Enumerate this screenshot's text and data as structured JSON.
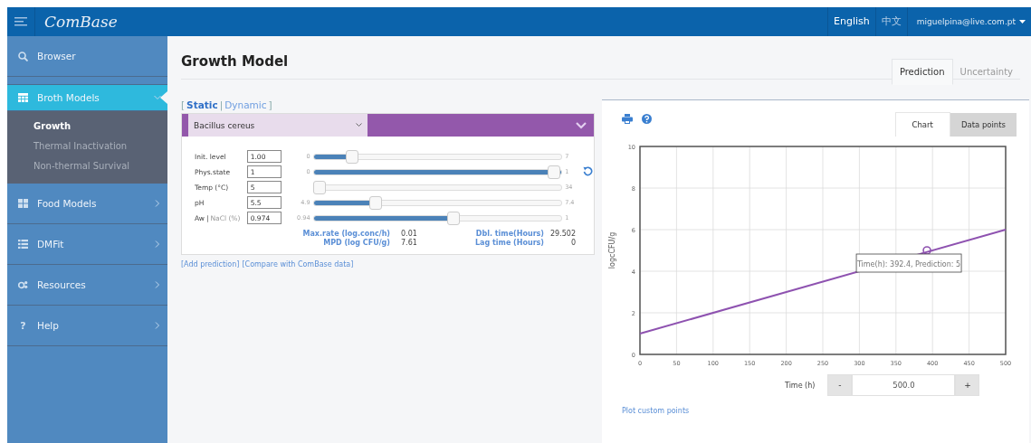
{
  "header": {
    "logo": "ComBase",
    "languages": [
      {
        "label": "English",
        "selected": true
      },
      {
        "label": "中文",
        "selected": false
      }
    ],
    "user": "miguelpina@live.com.pt"
  },
  "sidebar": {
    "items": [
      {
        "kind": "search",
        "label": "Browser",
        "selected": false
      },
      {
        "kind": "table",
        "label": "Broth Models",
        "selected": true,
        "expanded": true,
        "children": [
          {
            "label": "Growth",
            "selected": true
          },
          {
            "label": "Thermal Inactivation",
            "selected": false
          },
          {
            "label": "Non-thermal Survival",
            "selected": false
          }
        ]
      },
      {
        "kind": "tiles",
        "label": "Food Models",
        "selected": false,
        "expanded": false
      },
      {
        "kind": "list",
        "label": "DMFit",
        "selected": false,
        "expanded": false
      },
      {
        "kind": "cogs",
        "label": "Resources",
        "selected": false,
        "expanded": false
      },
      {
        "kind": "help",
        "glyph": "?",
        "label": "Help",
        "selected": false,
        "expanded": false
      }
    ]
  },
  "page": {
    "title": "Growth Model",
    "tabs": [
      {
        "label": "Prediction",
        "selected": true
      },
      {
        "label": "Uncertainty",
        "selected": false
      }
    ]
  },
  "mode": {
    "open": "[",
    "separator": "|",
    "close": "]",
    "options": [
      {
        "label": "Static",
        "selected": true
      },
      {
        "label": "Dynamic",
        "selected": false
      }
    ]
  },
  "organism": {
    "value": "Bacillus cereus"
  },
  "parameters": [
    {
      "label": "Init. level",
      "value": "1.00",
      "min": "0",
      "max": "7",
      "level": 0.14,
      "reset": false
    },
    {
      "label": "Phys.state",
      "value": "1",
      "min": "0",
      "max": "1",
      "level": 1,
      "reset": true
    },
    {
      "label": "Temp (°C)",
      "value": "5",
      "max": "34",
      "level": 0,
      "reset": false
    },
    {
      "label": "pH",
      "value": "5.5",
      "min": "4.9",
      "max": "7.4",
      "level": 0.24,
      "reset": false
    },
    {
      "label": "Aw",
      "separator": "|",
      "alt_label": "NaCl (%)",
      "value": "0.974",
      "min": "0.94",
      "max": "1",
      "level": 0.57,
      "reset": false
    }
  ],
  "results": [
    {
      "label": "Max.rate (log.conc/h)",
      "value": "0.01"
    },
    {
      "label": "Dbl. time(Hours)",
      "value": "29.502"
    },
    {
      "label": "MPD (log CFU/g)",
      "value": "7.61"
    },
    {
      "label": "Lag time (Hours)",
      "value": "0"
    }
  ],
  "links": [
    "[Add prediction]",
    "[Compare with ComBase data]"
  ],
  "chart_tabs": [
    {
      "label": "Chart",
      "selected": true
    },
    {
      "label": "Data points",
      "selected": false
    }
  ],
  "chart": {
    "chart_data": {
      "type": "line",
      "ylabel": "logcCFU/g",
      "x": [
        0,
        500
      ],
      "grid": true,
      "series": [
        {
          "color": "#8e52b0",
          "values": [
            1,
            6
          ]
        }
      ],
      "xlim": [
        0,
        500
      ],
      "ylim": [
        0,
        10
      ],
      "xticks": [
        0,
        50,
        100,
        150,
        200,
        250,
        300,
        350,
        400,
        450,
        500
      ],
      "yticks": [
        0,
        2,
        4,
        6,
        8,
        10
      ],
      "annotations": [
        {
          "x": 392.4,
          "y": 5,
          "text": "Time(h): 392.4, Prediction: 5"
        }
      ]
    }
  },
  "time": {
    "label": "Time (h)",
    "minus": "-",
    "value": "500.0",
    "plus": "+"
  },
  "plot_link": "Plot custom points"
}
